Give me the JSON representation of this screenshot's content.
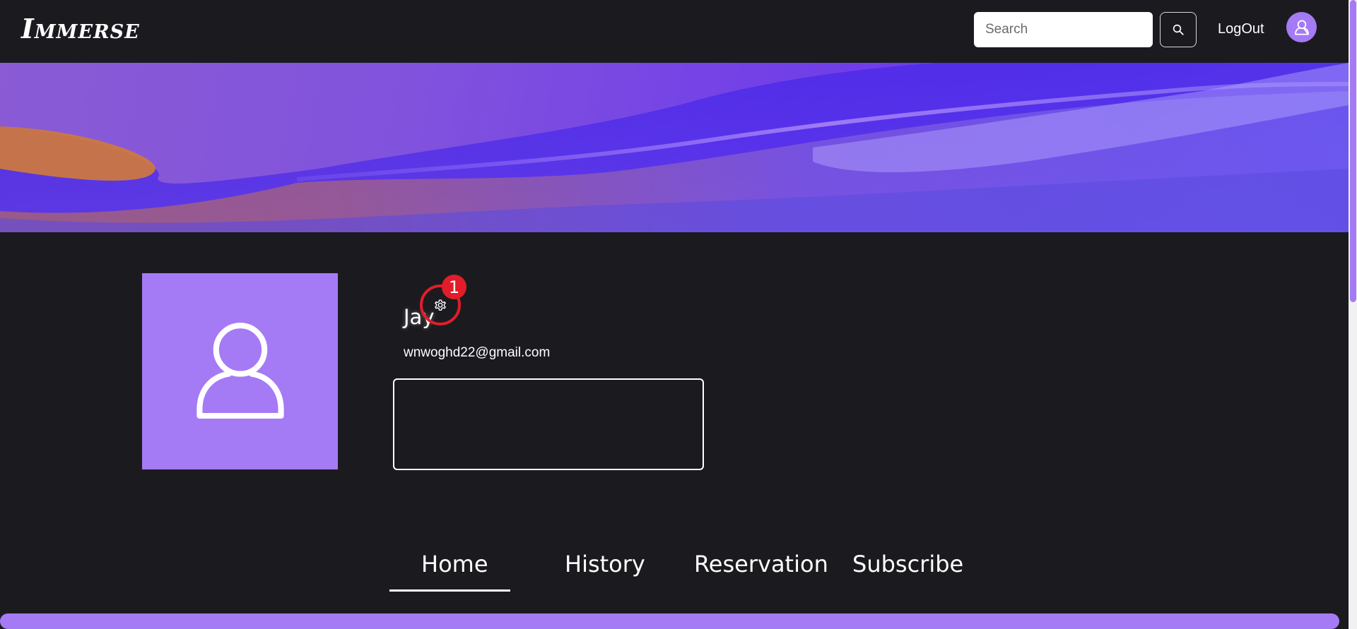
{
  "header": {
    "logo": "Immerse",
    "search": {
      "placeholder": "Search",
      "value": ""
    },
    "search_button_icon": "search-icon",
    "logout_label": "LogOut",
    "avatar_icon": "user-icon"
  },
  "profile": {
    "name": "Jay",
    "email": "wnwoghd22@gmail.com",
    "avatar_icon": "user-icon",
    "settings_icon": "gear-icon",
    "notification_count": "1",
    "bio": ""
  },
  "tabs": [
    {
      "label": "Home",
      "active": true
    },
    {
      "label": "History",
      "active": false
    },
    {
      "label": "Reservation",
      "active": false
    },
    {
      "label": "Subscribe",
      "active": false
    }
  ],
  "colors": {
    "background": "#1b1b1f",
    "accent": "#a57af5",
    "badge": "#e11d2a"
  }
}
